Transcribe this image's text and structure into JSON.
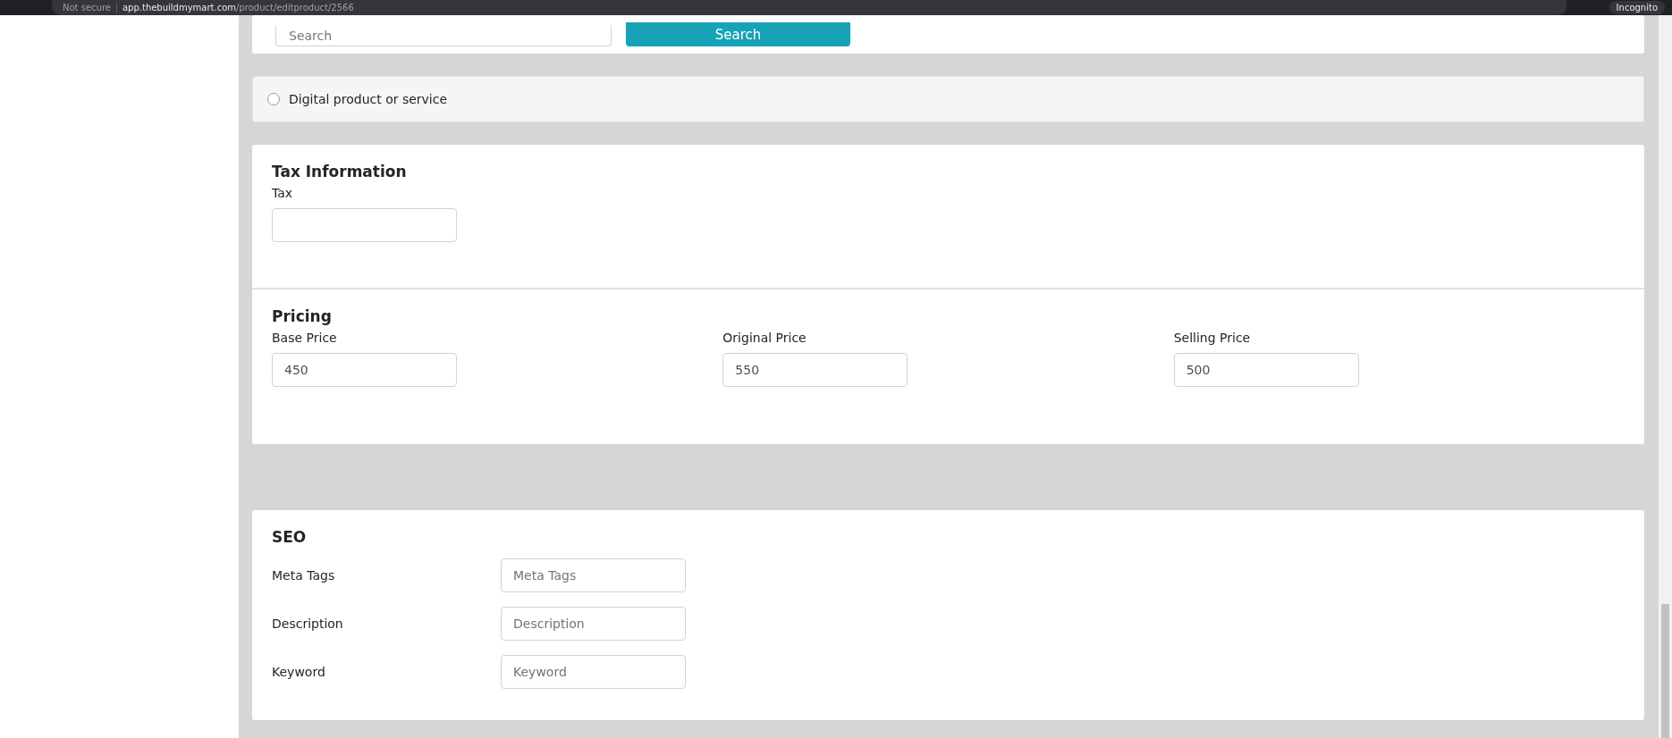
{
  "browser": {
    "security": "Not secure",
    "url_host": "app.thebuildmymart.com",
    "url_path": "/product/editproduct/2566",
    "profile": "Incognito"
  },
  "search": {
    "placeholder": "Search",
    "button": "Search"
  },
  "delivery": {
    "label": "Digital product or service",
    "selected": false
  },
  "tax": {
    "title": "Tax Information",
    "fields": [
      {
        "label": "Tax"
      }
    ]
  },
  "pricing": {
    "title": "Pricing",
    "fields": [
      {
        "label": "Base Price",
        "value": "450"
      },
      {
        "label": "Original Price",
        "value": "550"
      },
      {
        "label": "Selling Price",
        "value": "500"
      }
    ]
  },
  "seo": {
    "title": "SEO",
    "fields": [
      {
        "label": "Meta Tags",
        "placeholder": "Meta Tags"
      },
      {
        "label": "Description",
        "placeholder": "Description"
      },
      {
        "label": "Keyword",
        "placeholder": "Keyword"
      }
    ]
  }
}
